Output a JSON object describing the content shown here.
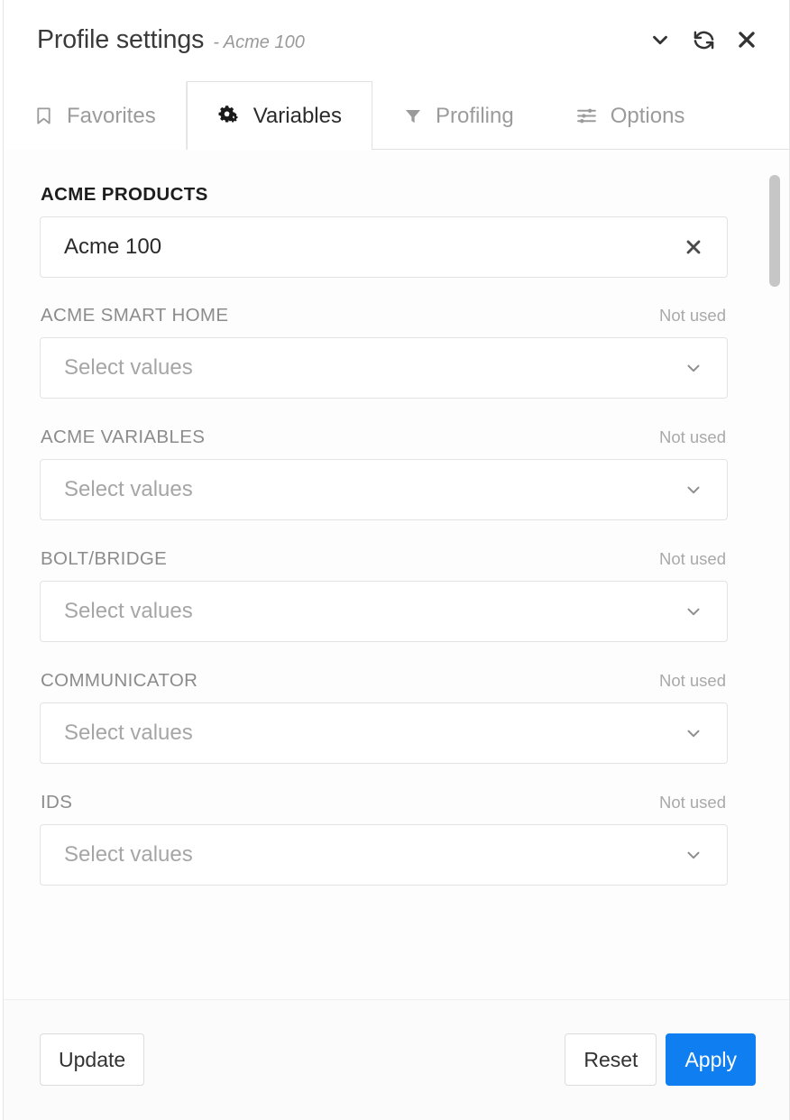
{
  "header": {
    "title": "Profile settings",
    "subtitle": "- Acme 100",
    "actions": [
      {
        "name": "collapse-button",
        "icon": "chevron-down-icon"
      },
      {
        "name": "refresh-button",
        "icon": "refresh-icon"
      },
      {
        "name": "close-button",
        "icon": "close-icon"
      }
    ]
  },
  "tabs": [
    {
      "label": "Favorites",
      "icon": "bookmark-icon",
      "active": false
    },
    {
      "label": "Variables",
      "icon": "gears-icon",
      "active": true
    },
    {
      "label": "Profiling",
      "icon": "filter-icon",
      "active": false
    },
    {
      "label": "Options",
      "icon": "sliders-icon",
      "active": false
    }
  ],
  "variables": {
    "groups": [
      {
        "label": "ACME PRODUCTS",
        "status": "",
        "used": true,
        "value": "Acme 100",
        "placeholder": "Select values",
        "action_icon": "close-icon"
      },
      {
        "label": "ACME SMART HOME",
        "status": "Not used",
        "used": false,
        "value": "",
        "placeholder": "Select values",
        "action_icon": "chevron-down-icon"
      },
      {
        "label": "ACME VARIABLES",
        "status": "Not used",
        "used": false,
        "value": "",
        "placeholder": "Select values",
        "action_icon": "chevron-down-icon"
      },
      {
        "label": "BOLT/BRIDGE",
        "status": "Not used",
        "used": false,
        "value": "",
        "placeholder": "Select values",
        "action_icon": "chevron-down-icon"
      },
      {
        "label": "COMMUNICATOR",
        "status": "Not used",
        "used": false,
        "value": "",
        "placeholder": "Select values",
        "action_icon": "chevron-down-icon"
      },
      {
        "label": "IDS",
        "status": "Not used",
        "used": false,
        "value": "",
        "placeholder": "Select values",
        "action_icon": "chevron-down-icon"
      }
    ]
  },
  "footer": {
    "update_label": "Update",
    "reset_label": "Reset",
    "apply_label": "Apply",
    "apply_color": "#0e7ef0"
  }
}
